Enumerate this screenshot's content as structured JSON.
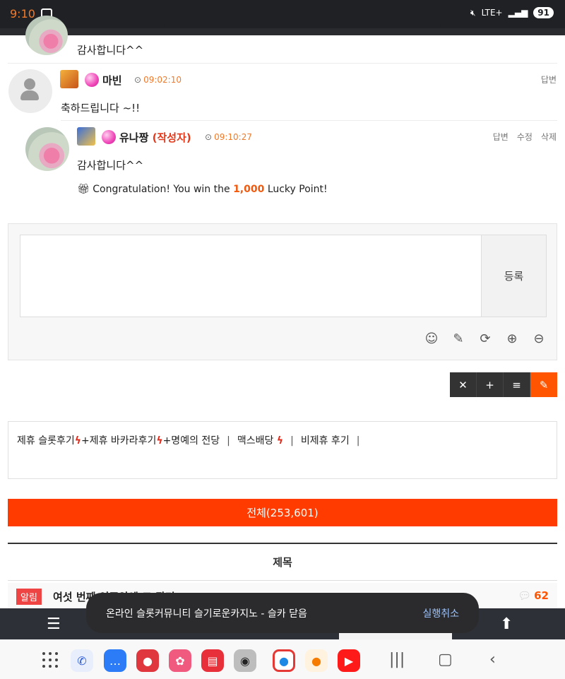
{
  "status_bar": {
    "time": "9:10",
    "signal": "LTE+",
    "battery": "91"
  },
  "comments": [
    {
      "text": "감사합니다^^"
    },
    {
      "nick": "마빈",
      "time": "09:02:10",
      "text": "축하드립니다 ~!!",
      "actions": [
        "답변"
      ]
    },
    {
      "nick": "유나짱",
      "author_tag": "(작성자)",
      "time": "09:10:27",
      "text": "감사합니다^^",
      "actions": [
        "답변",
        "수정",
        "삭제"
      ],
      "lucky": {
        "prefix": "Congratulation! You win the",
        "amount": "1,000",
        "suffix": "Lucky Point!"
      }
    }
  ],
  "comment_form": {
    "submit_label": "등록",
    "tools": [
      "smile-icon",
      "pencil-icon",
      "refresh-icon",
      "plus-circle-icon",
      "minus-circle-icon"
    ]
  },
  "button_group": [
    "close-icon",
    "plus-icon",
    "list-icon",
    "write-icon"
  ],
  "categories": [
    "제휴 슬롯후기",
    "+제휴 바카라후기",
    "+명예의 전당",
    "맥스배당",
    "비제휴 후기"
  ],
  "all_button": "전체(253,601)",
  "table_header": "제목",
  "notice": {
    "badge": "알림",
    "title": "여섯 번째 이주안에 모 관리",
    "count": "62"
  },
  "toast": {
    "message": "온라인 슬롯커뮤니티 슬기로운카지노 - 슬카 닫음",
    "action": "실행취소"
  }
}
